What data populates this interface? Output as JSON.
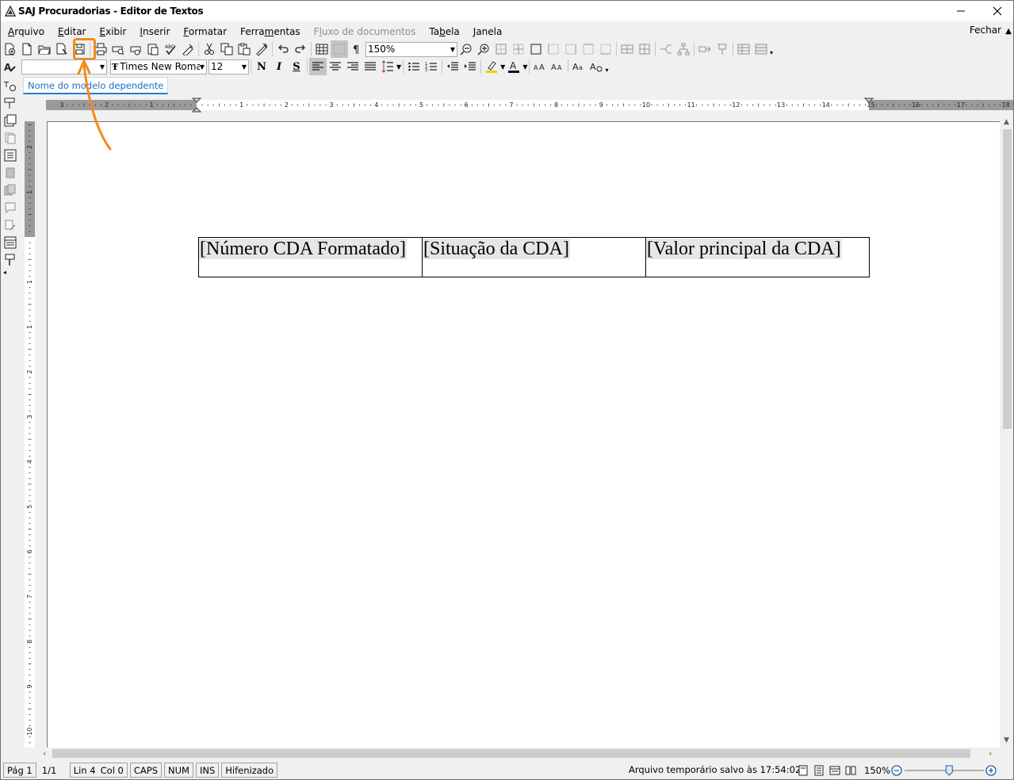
{
  "window": {
    "title": "SAJ Procuradorias - Editor de Textos"
  },
  "menubar": {
    "items": [
      {
        "label": "Arquivo",
        "accel_index": 0,
        "disabled": false
      },
      {
        "label": "Editar",
        "accel_index": 0,
        "disabled": false
      },
      {
        "label": "Exibir",
        "accel_index": 0,
        "disabled": false
      },
      {
        "label": "Inserir",
        "accel_index": 0,
        "disabled": false
      },
      {
        "label": "Formatar",
        "accel_index": 0,
        "disabled": false
      },
      {
        "label": "Ferramentas",
        "accel_index": 5,
        "disabled": false
      },
      {
        "label": "Fluxo de documentos",
        "accel_index": 1,
        "disabled": true
      },
      {
        "label": "Tabela",
        "accel_index": 2,
        "disabled": false
      },
      {
        "label": "Janela",
        "accel_index": 0,
        "disabled": false
      }
    ],
    "close_label": "Fechar"
  },
  "toolbar": {
    "zoom_value": "150%",
    "font_name": "Times New Roman",
    "font_size": "12",
    "bold": "N",
    "italic": "I",
    "underline": "S",
    "highlighted_button": "save-icon",
    "highlight_color": "#f28a1c"
  },
  "document_tab": {
    "label": "Nome do modelo dependente"
  },
  "rulers": {
    "horizontal_labels": [
      "3",
      "2",
      "1",
      "1",
      "2",
      "3",
      "4",
      "5",
      "6",
      "7",
      "8",
      "9",
      "10",
      "11",
      "12",
      "13",
      "14",
      "15",
      "16",
      "17",
      "18"
    ],
    "vertical_labels": [
      "2",
      "1",
      "1",
      "1",
      "2",
      "3",
      "4",
      "5",
      "6",
      "7",
      "8",
      "9",
      "10",
      "11"
    ]
  },
  "document": {
    "table": {
      "cells": [
        "[Número CDA Formatado]",
        "[Situação da CDA]",
        "[Valor principal da CDA]"
      ]
    }
  },
  "statusbar": {
    "page": "Pág 1",
    "page_count": "1/1",
    "line": "Lin 4",
    "col": "Col 0",
    "caps": "CAPS",
    "num": "NUM",
    "ins": "INS",
    "hyphen": "Hifenizado",
    "saved_msg": "Arquivo temporário salvo às 17:54:02",
    "zoom": "150%",
    "zoom_level_percent": 150
  }
}
